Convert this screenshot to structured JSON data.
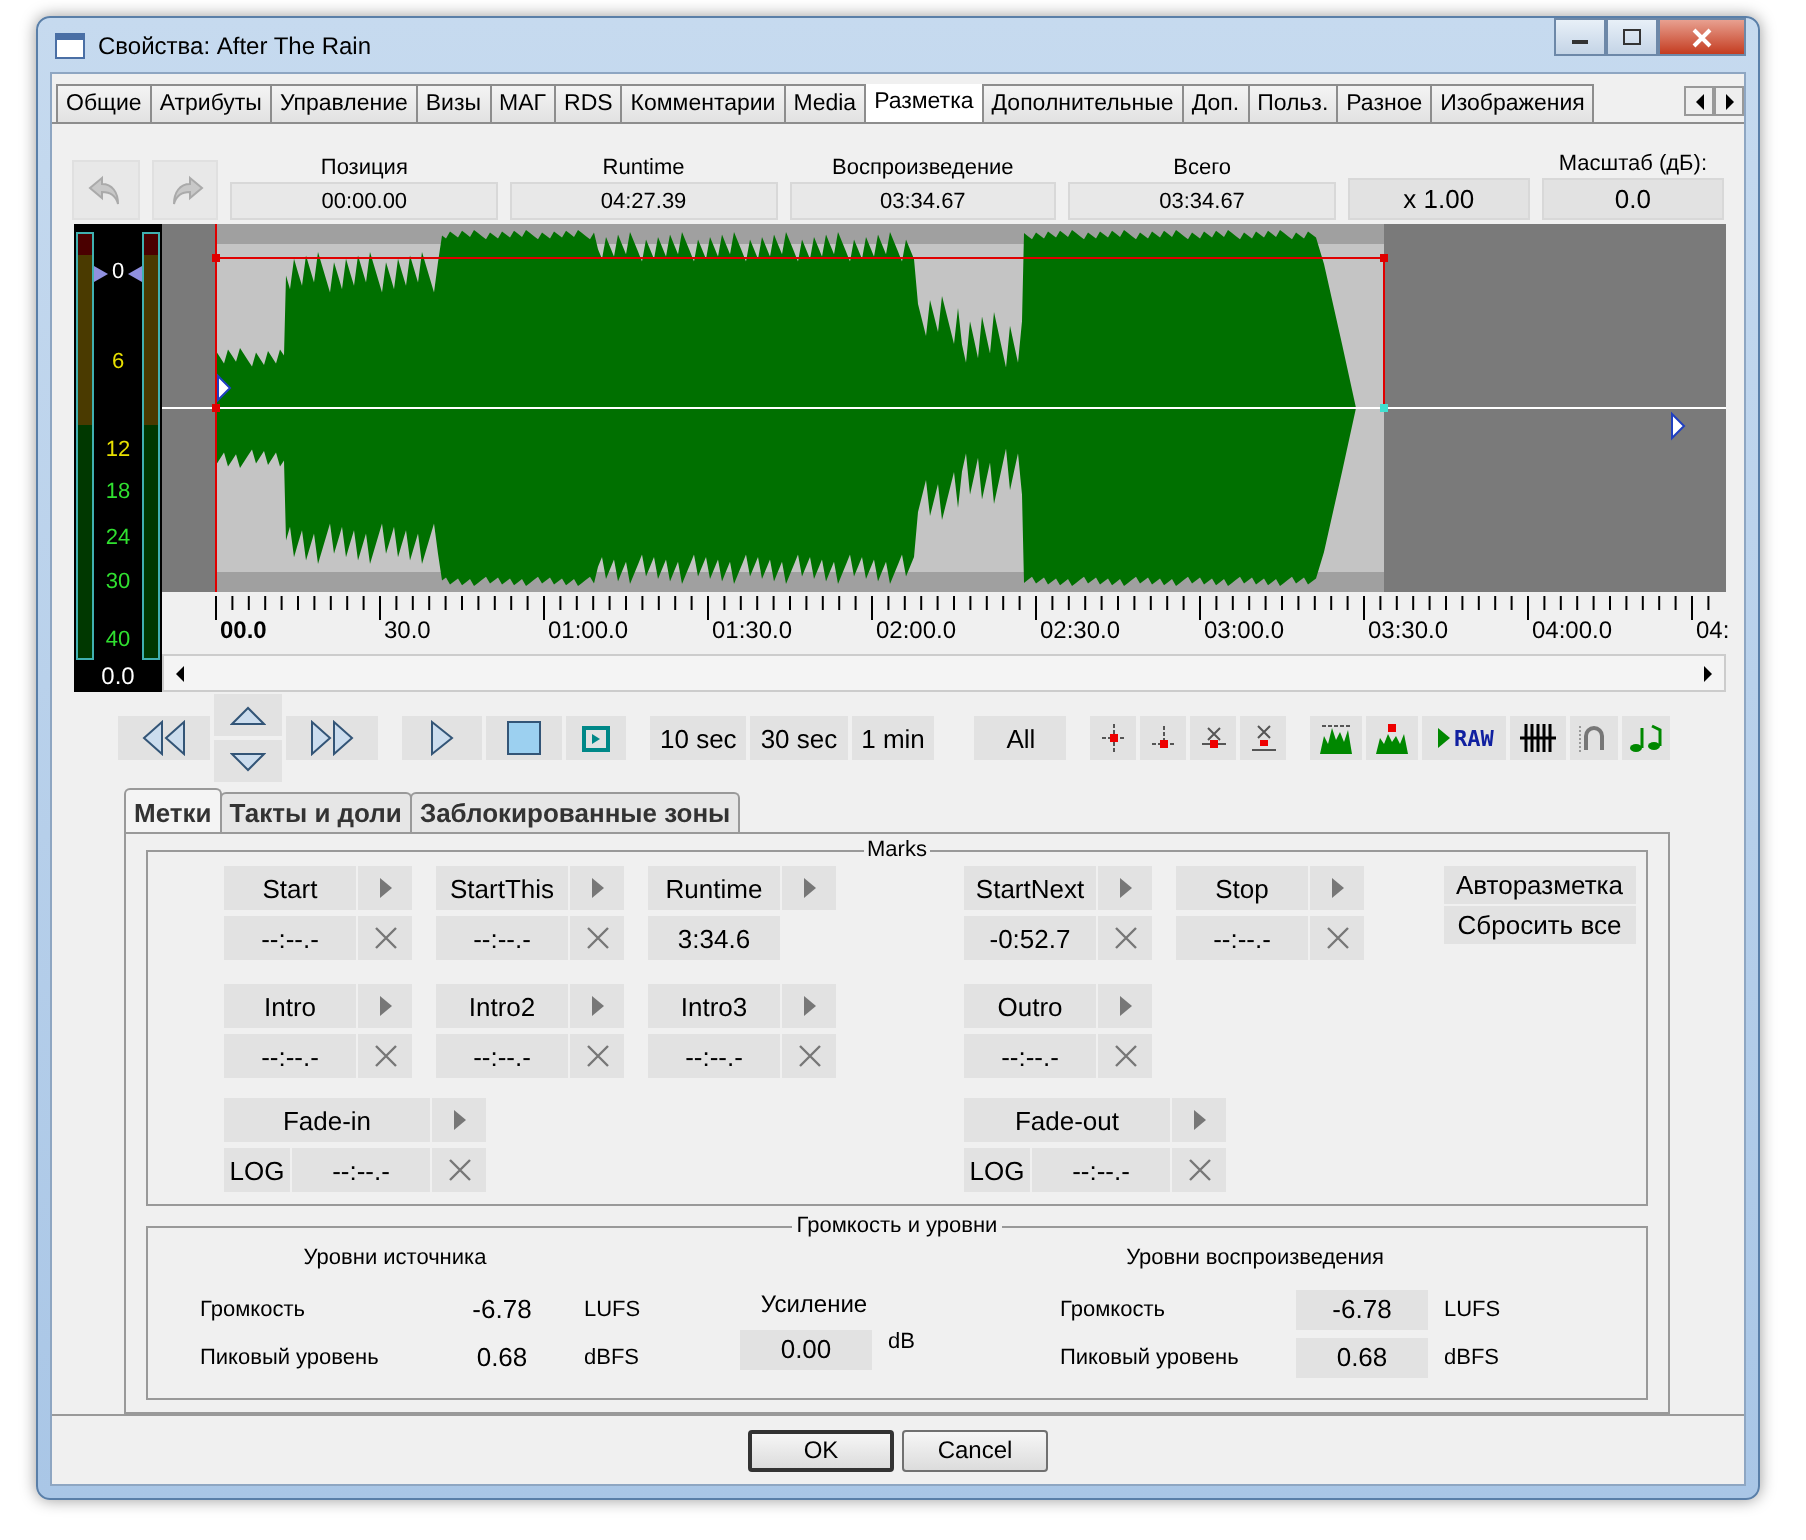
{
  "window": {
    "title": "Свойства: After The Rain"
  },
  "tabs": [
    {
      "label": "Общие",
      "selected": false
    },
    {
      "label": "Атрибуты",
      "selected": false
    },
    {
      "label": "Управление",
      "selected": false
    },
    {
      "label": "Визы",
      "selected": false
    },
    {
      "label": "МАГ",
      "selected": false
    },
    {
      "label": "RDS",
      "selected": false
    },
    {
      "label": "Комментарии",
      "selected": false
    },
    {
      "label": "Media",
      "selected": false
    },
    {
      "label": "Разметка",
      "selected": true
    },
    {
      "label": "Дополнительные",
      "selected": false
    },
    {
      "label": "Доп.",
      "selected": false
    },
    {
      "label": "Польз.",
      "selected": false
    },
    {
      "label": "Разное",
      "selected": false
    },
    {
      "label": "Изображения",
      "selected": false
    }
  ],
  "counters": [
    {
      "label": "Позиция",
      "value": "00:00.00"
    },
    {
      "label": "Runtime",
      "value": "04:27.39"
    },
    {
      "label": "Воспроизведение",
      "value": "03:34.67"
    },
    {
      "label": "Всего",
      "value": "03:34.67"
    }
  ],
  "speed": "x 1.00",
  "scale": {
    "label": "Масштаб (дБ):",
    "value": "0.0"
  },
  "meter": {
    "ticks": [
      "0",
      "6",
      "12",
      "18",
      "24",
      "30",
      "40"
    ],
    "reading": "0.0"
  },
  "ruler": [
    "00.0",
    "30.0",
    "01:00.0",
    "01:30.0",
    "02:00.0",
    "02:30.0",
    "03:00.0",
    "03:30.0",
    "04:00.0",
    "04:"
  ],
  "zoom_buttons": [
    "10 sec",
    "30 sec",
    "1 min",
    "All"
  ],
  "raw_button": "RAW",
  "subtabs": [
    {
      "label": "Метки",
      "selected": true
    },
    {
      "label": "Такты и доли",
      "selected": false
    },
    {
      "label": "Заблокированные зоны",
      "selected": false
    }
  ],
  "marks": {
    "title": "Marks",
    "left": [
      [
        {
          "kind": "mark",
          "label": "Start",
          "value": "--:--.-"
        },
        {
          "kind": "mark",
          "label": "StartThis",
          "value": "--:--.-"
        },
        {
          "kind": "readout",
          "label": "Runtime",
          "value": "3:34.6"
        }
      ],
      [
        {
          "kind": "mark",
          "label": "Intro",
          "value": "--:--.-"
        },
        {
          "kind": "mark",
          "label": "Intro2",
          "value": "--:--.-"
        },
        {
          "kind": "mark",
          "label": "Intro3",
          "value": "--:--.-"
        }
      ],
      [
        {
          "kind": "fade",
          "label": "Fade-in",
          "mode": "LOG",
          "value": "--:--.-"
        }
      ]
    ],
    "right": [
      [
        {
          "kind": "mark",
          "label": "StartNext",
          "value": "-0:52.7"
        },
        {
          "kind": "mark",
          "label": "Stop",
          "value": "--:--.-"
        }
      ],
      [
        {
          "kind": "mark",
          "label": "Outro",
          "value": "--:--.-"
        }
      ],
      [
        {
          "kind": "fade",
          "label": "Fade-out",
          "mode": "LOG",
          "value": "--:--.-"
        }
      ]
    ],
    "buttons": [
      "Авторазметка",
      "Сбросить все"
    ]
  },
  "levels": {
    "title": "Громкость и уровни",
    "source": {
      "title": "Уровни источника",
      "rows": [
        {
          "label": "Громкость",
          "value": "-6.78",
          "unit": "LUFS"
        },
        {
          "label": "Пиковый уровень",
          "value": "0.68",
          "unit": "dBFS"
        }
      ]
    },
    "gain": {
      "label": "Усиление",
      "value": "0.00",
      "unit": "dB"
    },
    "playback": {
      "title": "Уровни воспроизведения",
      "rows": [
        {
          "label": "Громкость",
          "value": "-6.78",
          "unit": "LUFS"
        },
        {
          "label": "Пиковый уровень",
          "value": "0.68",
          "unit": "dBFS"
        }
      ]
    }
  },
  "buttons": [
    "OK",
    "Cancel"
  ]
}
